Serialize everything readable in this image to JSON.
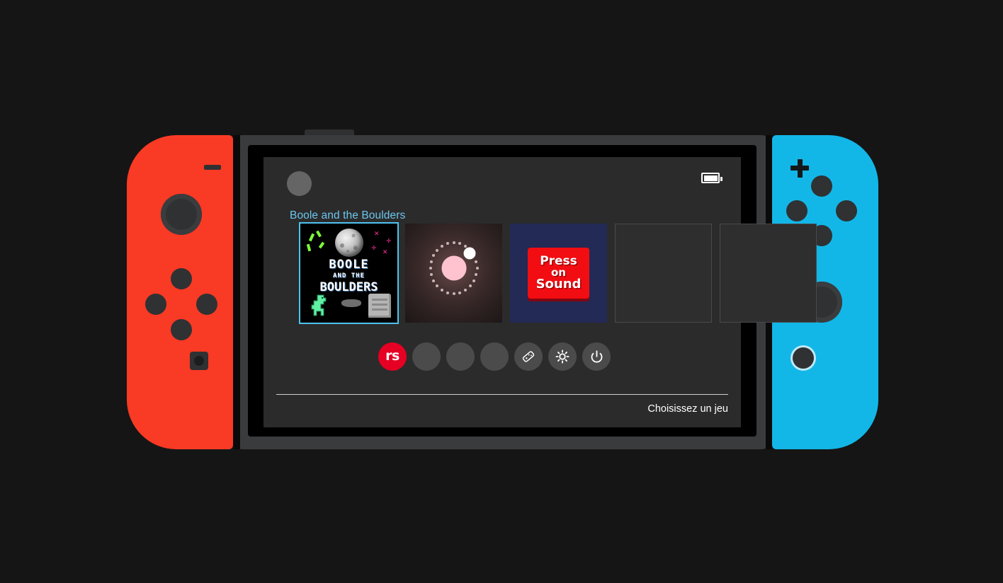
{
  "device": {
    "name": "nintendo-switch",
    "left_joycon_color": "#f93a24",
    "right_joycon_color": "#12b7e8",
    "body_color": "#3a3b3d",
    "screen_bg": "#2b2b2b",
    "left_controls": {
      "minus_label": "−",
      "stick_label": "left-analog-stick",
      "dpad_up": "up",
      "dpad_left": "left",
      "dpad_right": "right",
      "dpad_down": "down",
      "capture_label": "capture"
    },
    "right_controls": {
      "plus_label": "+",
      "button_x": "X",
      "button_y": "Y",
      "button_a": "A",
      "button_b": "B",
      "stick_label": "right-analog-stick",
      "home_label": "home"
    }
  },
  "screen": {
    "topbar": {
      "avatar_label": "user-avatar",
      "battery_label": "battery-full"
    },
    "selected_game_title": "Boole and the Boulders",
    "accent_color": "#6cc6ee",
    "tiles": [
      {
        "id": "boole-and-the-boulders",
        "name": "Boole and the Boulders",
        "selected": true,
        "art": {
          "line1": "BOOLE",
          "line2": "AND THE",
          "line3": "BOULDERS",
          "bg": "#000000",
          "dino_color": "#5ff0a4",
          "leaf_color": "#7dfb3a",
          "spark_color": "#ff2f9d"
        }
      },
      {
        "id": "orbit-game",
        "name": "",
        "selected": false,
        "art": {
          "core_color": "#ffc3cf",
          "moon_color": "#ffffff",
          "bg": "#3c2b2b"
        }
      },
      {
        "id": "press-on-sound",
        "name": "Press on Sound",
        "selected": false,
        "art": {
          "line1": "Press",
          "line2": "on",
          "line3": "Sound",
          "card_color": "#f20d12",
          "bg": "#232a55"
        }
      },
      {
        "id": "empty-slot-1",
        "name": "",
        "selected": false,
        "empty": true
      },
      {
        "id": "empty-slot-2",
        "name": "",
        "selected": false,
        "empty": true
      }
    ],
    "dock": [
      {
        "id": "brand",
        "label": "rs",
        "icon": "rs-logo-icon",
        "accent": "#e60023"
      },
      {
        "id": "slot-1",
        "label": "",
        "icon": "blank-icon"
      },
      {
        "id": "slot-2",
        "label": "",
        "icon": "blank-icon"
      },
      {
        "id": "slot-3",
        "label": "",
        "icon": "blank-icon"
      },
      {
        "id": "controllers",
        "label": "",
        "icon": "controller-icon"
      },
      {
        "id": "brightness",
        "label": "",
        "icon": "brightness-sun-icon"
      },
      {
        "id": "power",
        "label": "",
        "icon": "power-icon"
      }
    ],
    "footer": {
      "hint": "Choisissez un jeu"
    }
  }
}
